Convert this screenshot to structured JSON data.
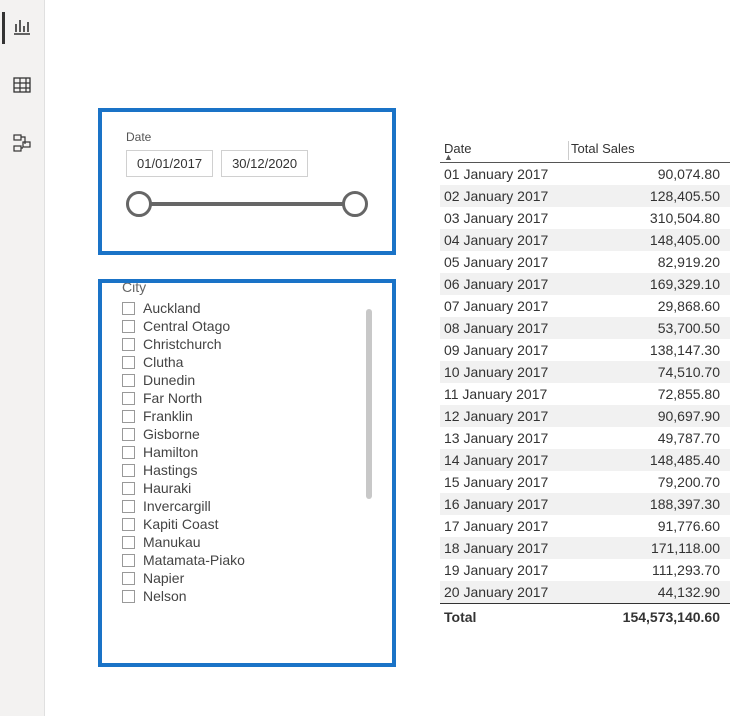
{
  "nav": {
    "items": [
      {
        "name": "report-view",
        "icon": "bar-chart-icon",
        "active": true
      },
      {
        "name": "data-view",
        "icon": "table-icon",
        "active": false
      },
      {
        "name": "model-view",
        "icon": "model-icon",
        "active": false
      }
    ]
  },
  "date_slicer": {
    "label": "Date",
    "from": "01/01/2017",
    "to": "30/12/2020"
  },
  "city_slicer": {
    "title": "City",
    "items": [
      {
        "label": "Auckland",
        "checked": false
      },
      {
        "label": "Central Otago",
        "checked": false
      },
      {
        "label": "Christchurch",
        "checked": false
      },
      {
        "label": "Clutha",
        "checked": false
      },
      {
        "label": "Dunedin",
        "checked": false
      },
      {
        "label": "Far North",
        "checked": false
      },
      {
        "label": "Franklin",
        "checked": false
      },
      {
        "label": "Gisborne",
        "checked": false
      },
      {
        "label": "Hamilton",
        "checked": false
      },
      {
        "label": "Hastings",
        "checked": false
      },
      {
        "label": "Hauraki",
        "checked": false
      },
      {
        "label": "Invercargill",
        "checked": false
      },
      {
        "label": "Kapiti Coast",
        "checked": false
      },
      {
        "label": "Manukau",
        "checked": false
      },
      {
        "label": "Matamata-Piako",
        "checked": false
      },
      {
        "label": "Napier",
        "checked": false
      },
      {
        "label": "Nelson",
        "checked": false
      }
    ]
  },
  "sales_table": {
    "columns": {
      "date": "Date",
      "sales": "Total Sales"
    },
    "sort_indicator": "▲",
    "rows": [
      {
        "date": "01 January 2017",
        "sales": "90,074.80"
      },
      {
        "date": "02 January 2017",
        "sales": "128,405.50"
      },
      {
        "date": "03 January 2017",
        "sales": "310,504.80"
      },
      {
        "date": "04 January 2017",
        "sales": "148,405.00"
      },
      {
        "date": "05 January 2017",
        "sales": "82,919.20"
      },
      {
        "date": "06 January 2017",
        "sales": "169,329.10"
      },
      {
        "date": "07 January 2017",
        "sales": "29,868.60"
      },
      {
        "date": "08 January 2017",
        "sales": "53,700.50"
      },
      {
        "date": "09 January 2017",
        "sales": "138,147.30"
      },
      {
        "date": "10 January 2017",
        "sales": "74,510.70"
      },
      {
        "date": "11 January 2017",
        "sales": "72,855.80"
      },
      {
        "date": "12 January 2017",
        "sales": "90,697.90"
      },
      {
        "date": "13 January 2017",
        "sales": "49,787.70"
      },
      {
        "date": "14 January 2017",
        "sales": "148,485.40"
      },
      {
        "date": "15 January 2017",
        "sales": "79,200.70"
      },
      {
        "date": "16 January 2017",
        "sales": "188,397.30"
      },
      {
        "date": "17 January 2017",
        "sales": "91,776.60"
      },
      {
        "date": "18 January 2017",
        "sales": "171,118.00"
      },
      {
        "date": "19 January 2017",
        "sales": "111,293.70"
      },
      {
        "date": "20 January 2017",
        "sales": "44,132.90"
      }
    ],
    "total_label": "Total",
    "total_value": "154,573,140.60"
  }
}
